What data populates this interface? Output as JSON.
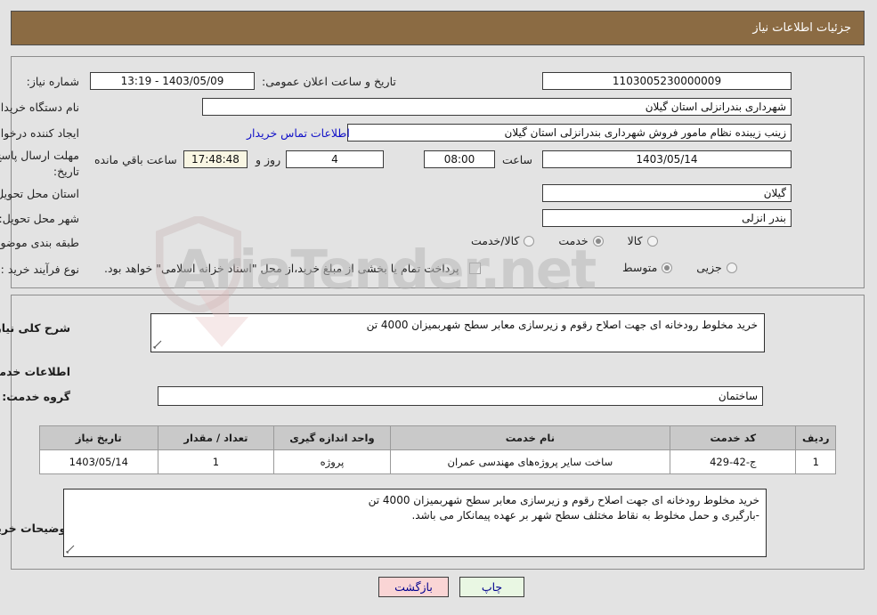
{
  "header": {
    "title": "جزئیات اطلاعات نیاز"
  },
  "watermark": {
    "text": "AriaTender.net"
  },
  "top_panel": {
    "need_number": {
      "label": "شماره نیاز:",
      "value": "1103005230000009"
    },
    "buyer_org": {
      "label": "نام دستگاه خریدار:",
      "value": "شهرداری بندرانزلی استان گیلان"
    },
    "requester": {
      "label": "ایجاد کننده درخواست:",
      "value": "زینب زیبنده نظام مامور فروش شهرداری بندرانزلی استان گیلان"
    },
    "announce_datetime": {
      "label": "تاریخ و ساعت اعلان عمومی:",
      "value": "1403/05/09 - 13:19"
    },
    "contact_link": {
      "label": "اطلاعات تماس خریدار"
    },
    "deadline": {
      "label": "مهلت ارسال پاسخ: تا تاریخ:",
      "label_line1": "مهلت ارسال پاسخ: تا",
      "label_line2": "تاریخ:",
      "date": "1403/05/14",
      "time_label": "ساعت",
      "time": "08:00",
      "days": "4",
      "days_suffix": "روز و",
      "countdown": "17:48:48",
      "countdown_suffix": "ساعت باقي مانده"
    },
    "province": {
      "label": "استان محل تحویل:",
      "value": "گیلان"
    },
    "city": {
      "label": "شهر محل تحویل:",
      "value": "بندر انزلی"
    },
    "category": {
      "label": "طبقه بندی موضوعی:",
      "options": [
        "کالا",
        "خدمت",
        "کالا/خدمت"
      ],
      "selected": "خدمت"
    },
    "purchase_type": {
      "label": "نوع فرآیند خرید :",
      "options": [
        "جزیی",
        "متوسط"
      ],
      "selected": "متوسط",
      "treasury_note": "پرداخت تمام یا بخشی از مبلغ خرید،از محل \"اسناد خزانه اسلامی\" خواهد بود.",
      "treasury_checked": false
    }
  },
  "bottom_panel": {
    "general_desc": {
      "label": "شرح کلی نیاز:",
      "value": "خرید مخلوط رودخانه ای جهت اصلاح رقوم و زیرسازی معابر سطح شهربمیزان 4000 تن"
    },
    "services_section_title": "اطلاعات خدمات مورد نیاز",
    "service_group": {
      "label": "گروه خدمت:",
      "value": "ساختمان"
    },
    "table": {
      "columns": [
        "ردیف",
        "کد خدمت",
        "نام خدمت",
        "واحد اندازه گیری",
        "تعداد / مقدار",
        "تاریخ نیاز"
      ],
      "rows": [
        {
          "row": "1",
          "service_code": "ج-42-429",
          "service_name": "ساخت سایر پروژه‌های مهندسی عمران",
          "unit": "پروژه",
          "quantity": "1",
          "need_date": "1403/05/14"
        }
      ]
    },
    "buyer_notes": {
      "label": "توضیحات خریدار:",
      "line1": "خرید مخلوط رودخانه ای جهت اصلاح رقوم و زیرسازی معابر سطح شهربمیزان 4000 تن",
      "line2": "-بارگیری و حمل مخلوط به نقاط مختلف سطح شهر بر عهده پیمانکار می باشد."
    }
  },
  "footer": {
    "back_button": "بازگشت",
    "print_button": "چاپ"
  },
  "colors": {
    "header_bar": "#8b6b43",
    "page_bg": "#e3e3e3",
    "link": "#1010c8",
    "back_btn": "#fad5d5",
    "print_btn": "#e9f7e3",
    "countdown_bg": "#f9f6e3",
    "table_header": "#c9c9c9"
  }
}
